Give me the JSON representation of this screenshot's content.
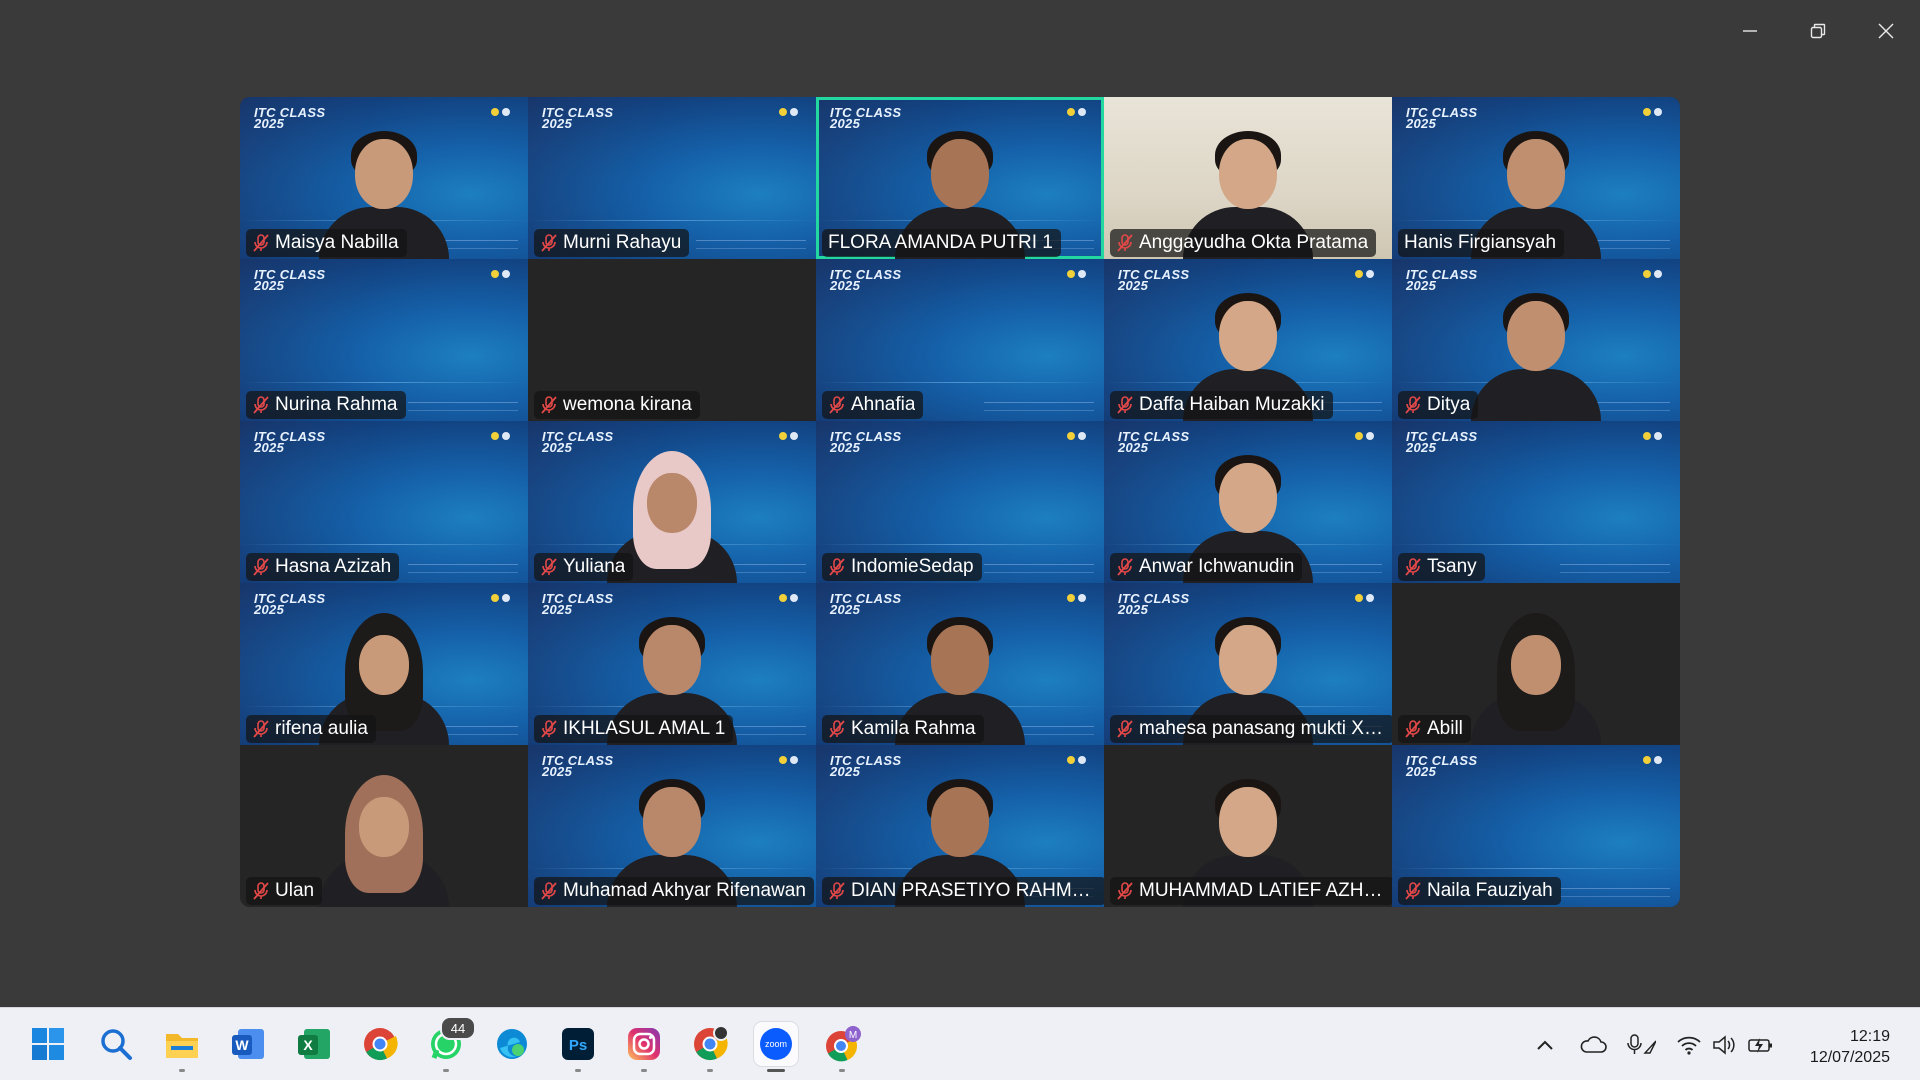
{
  "window": {
    "controls": [
      "minimize",
      "restore",
      "close"
    ]
  },
  "gallery": {
    "brand_line1": "ITC CLASS",
    "brand_line2": "2025",
    "participants": [
      {
        "name": "Maisya Nabilla",
        "video": "blue",
        "muted": true
      },
      {
        "name": "Murni Rahayu",
        "video": "blue",
        "muted": true
      },
      {
        "name": "FLORA AMANDA PUTRI 1",
        "video": "blue",
        "muted": false,
        "active_speaker": true
      },
      {
        "name": "Anggayudha Okta Pratama",
        "video": "room",
        "muted": true
      },
      {
        "name": "Hanis Firgiansyah",
        "video": "blue",
        "muted": false
      },
      {
        "name": "Nurina Rahma",
        "video": "blue",
        "muted": true
      },
      {
        "name": "wemona kirana",
        "video": "black",
        "muted": true
      },
      {
        "name": "Ahnafia",
        "video": "blue",
        "muted": true
      },
      {
        "name": "Daffa Haiban Muzakki",
        "video": "blue",
        "muted": true
      },
      {
        "name": "Ditya",
        "video": "blue",
        "muted": true
      },
      {
        "name": "Hasna Azizah",
        "video": "blue",
        "muted": true
      },
      {
        "name": "Yuliana",
        "video": "blue",
        "muted": true
      },
      {
        "name": "IndomieSedap",
        "video": "blue",
        "muted": true
      },
      {
        "name": "Anwar Ichwanudin",
        "video": "blue",
        "muted": true
      },
      {
        "name": "Tsany",
        "video": "blue",
        "muted": true
      },
      {
        "name": "rifena aulia",
        "video": "blue",
        "muted": true
      },
      {
        "name": "IKHLASUL AMAL 1",
        "video": "blue",
        "muted": true
      },
      {
        "name": "Kamila Rahma",
        "video": "blue",
        "muted": true
      },
      {
        "name": "mahesa panasang mukti XII ...",
        "video": "blue",
        "muted": true
      },
      {
        "name": "Abill",
        "video": "black",
        "muted": true
      },
      {
        "name": "Ulan",
        "video": "black",
        "muted": true
      },
      {
        "name": "Muhamad Akhyar Rifenawan",
        "video": "blue",
        "muted": true
      },
      {
        "name": "DIAN PRASETIYO RAHMAN",
        "video": "blue",
        "muted": true
      },
      {
        "name": "MUHAMMAD LATIEF AZHAR...",
        "video": "black",
        "muted": true
      },
      {
        "name": "Naila Fauziyah",
        "video": "blue",
        "muted": true
      }
    ]
  },
  "taskbar": {
    "apps": [
      {
        "icon": "windows-start-icon"
      },
      {
        "icon": "search-icon"
      },
      {
        "icon": "file-explorer-icon"
      },
      {
        "icon": "word-icon",
        "text": "W"
      },
      {
        "icon": "excel-icon",
        "text": "X"
      },
      {
        "icon": "chrome-icon"
      },
      {
        "icon": "whatsapp-icon",
        "badge": "44"
      },
      {
        "icon": "edge-icon"
      },
      {
        "icon": "photoshop-icon",
        "text": "Ps"
      },
      {
        "icon": "instagram-icon"
      },
      {
        "icon": "chrome-profile-icon"
      },
      {
        "icon": "zoom-icon",
        "text": "zoom"
      },
      {
        "icon": "chrome-profile-m-icon",
        "text": "M"
      }
    ],
    "clock": {
      "time": "12:19",
      "date": "12/07/2025"
    }
  },
  "colors": {
    "active_speaker_border": "#22d8a0",
    "muted_mic": "#e24848",
    "tile_blue": "#1560a8"
  }
}
